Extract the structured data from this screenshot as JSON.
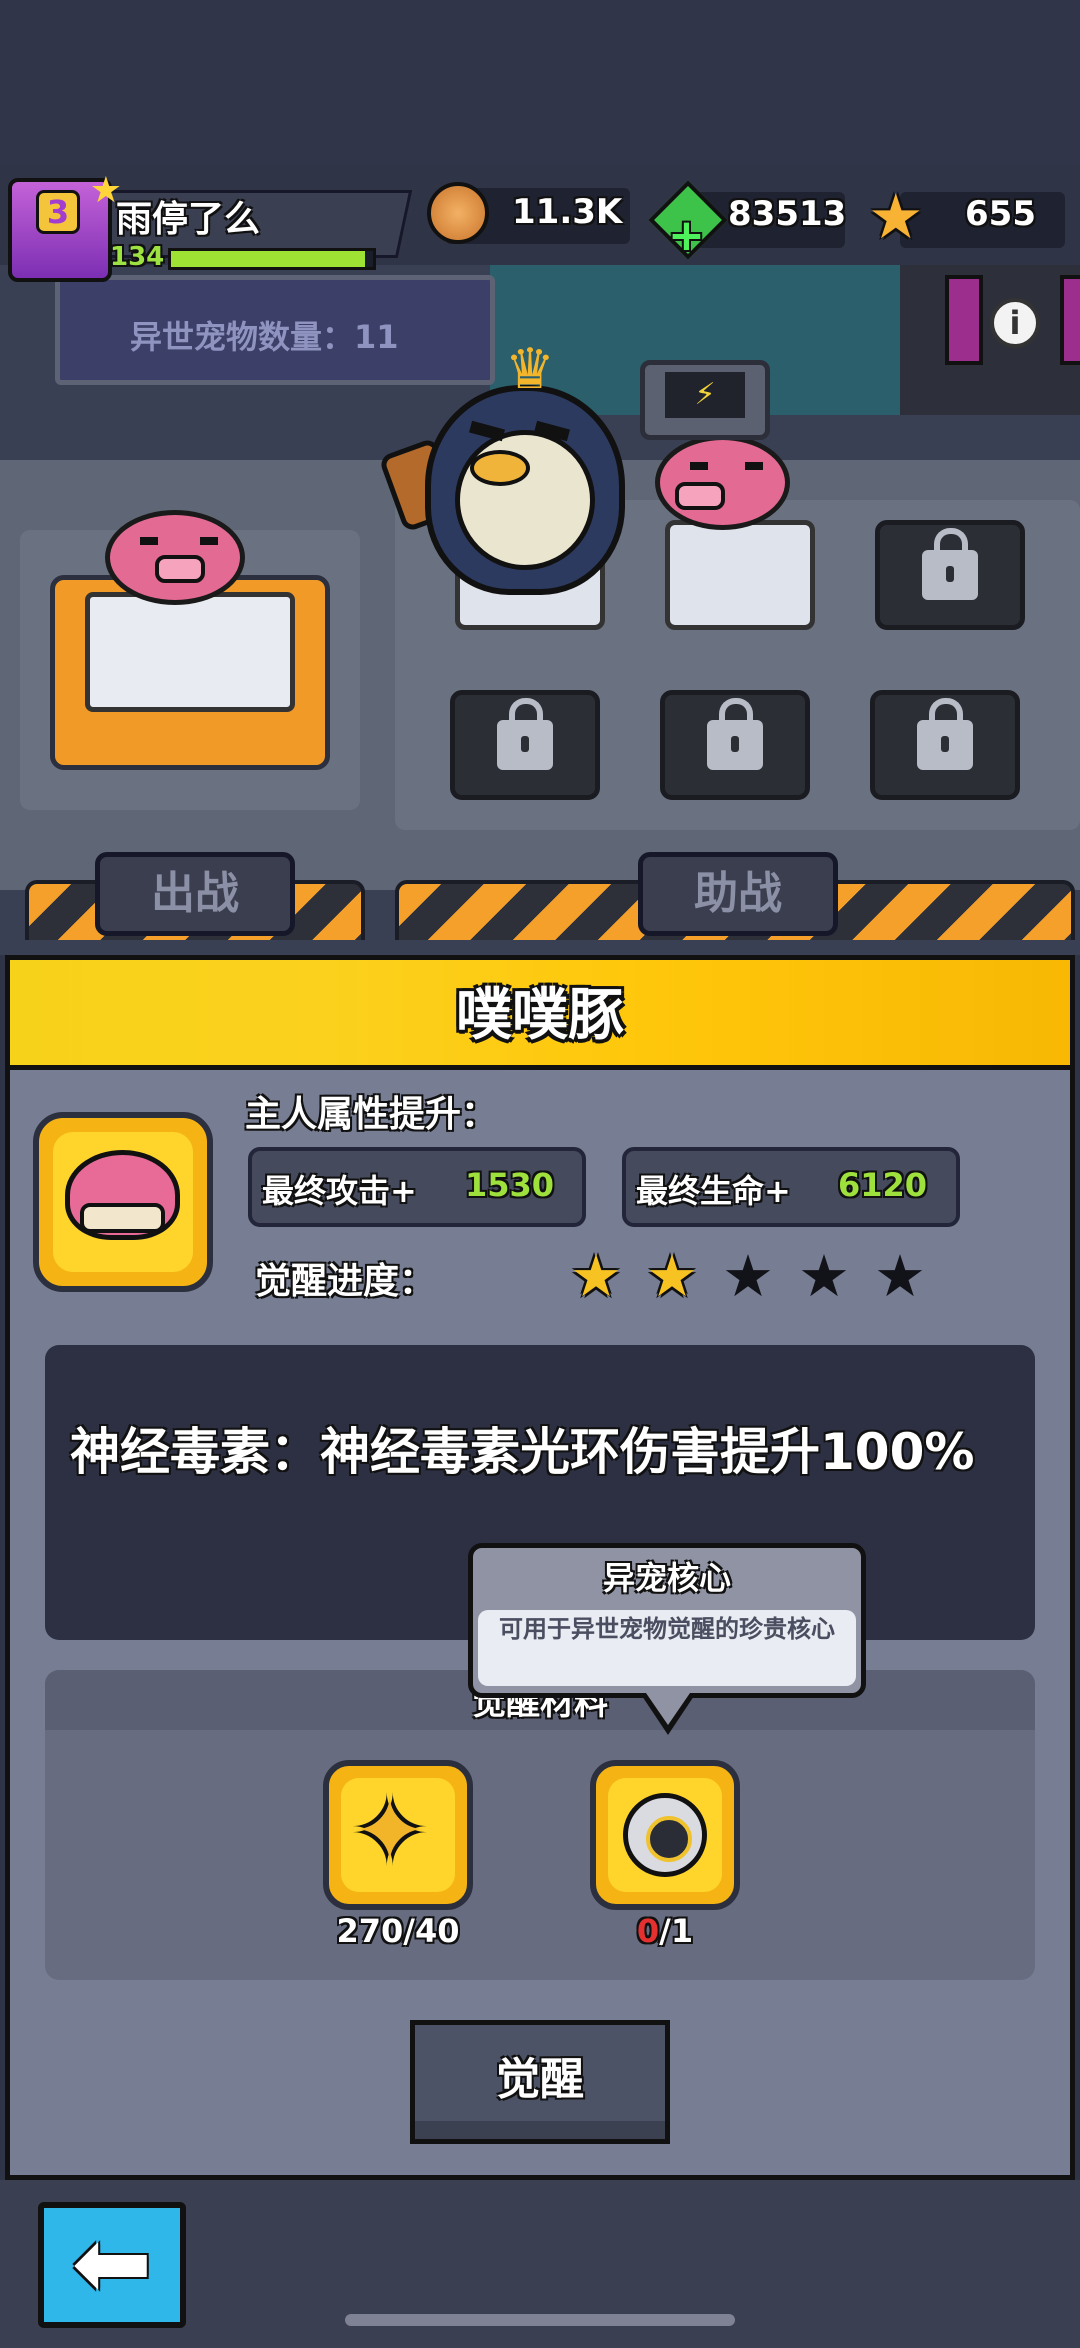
{
  "player": {
    "level_badge": "3",
    "name": "雨停了么",
    "level": "134",
    "xp_fraction": 0.96
  },
  "currencies": [
    {
      "icon": "coin-icon",
      "value": "11.3K"
    },
    {
      "icon": "gem-icon",
      "value": "83513"
    },
    {
      "icon": "star-currency-icon",
      "value": "655"
    }
  ],
  "scene": {
    "pet_count_label": "异世宠物数量：11",
    "tabs": {
      "battle": "出战",
      "assist": "助战"
    }
  },
  "pet_detail": {
    "title": "噗噗豚",
    "owner_boost_label": "主人属性提升：",
    "stats": [
      {
        "label": "最终攻击+",
        "value": "1530"
      },
      {
        "label": "最终生命+",
        "value": "6120"
      }
    ],
    "awaken_progress_label": "觉醒进度：",
    "awaken_stars": {
      "filled": 2,
      "total": 5
    },
    "skill_text": "神经毒素：神经毒素光环伤害提升100%",
    "materials_label": "觉醒材料",
    "materials": [
      {
        "icon": "star-shard-icon",
        "have": "270",
        "need": "/40"
      },
      {
        "icon": "pet-core-icon",
        "have": "0",
        "need": "/1"
      }
    ],
    "tooltip": {
      "title": "异宠核心",
      "description": "可用于异世宠物觉醒的珍贵核心"
    },
    "awaken_button": "觉醒"
  },
  "colors": {
    "accent_yellow": "#f7c322",
    "stat_green": "#9ee03c",
    "back_blue": "#2fb7e9"
  }
}
